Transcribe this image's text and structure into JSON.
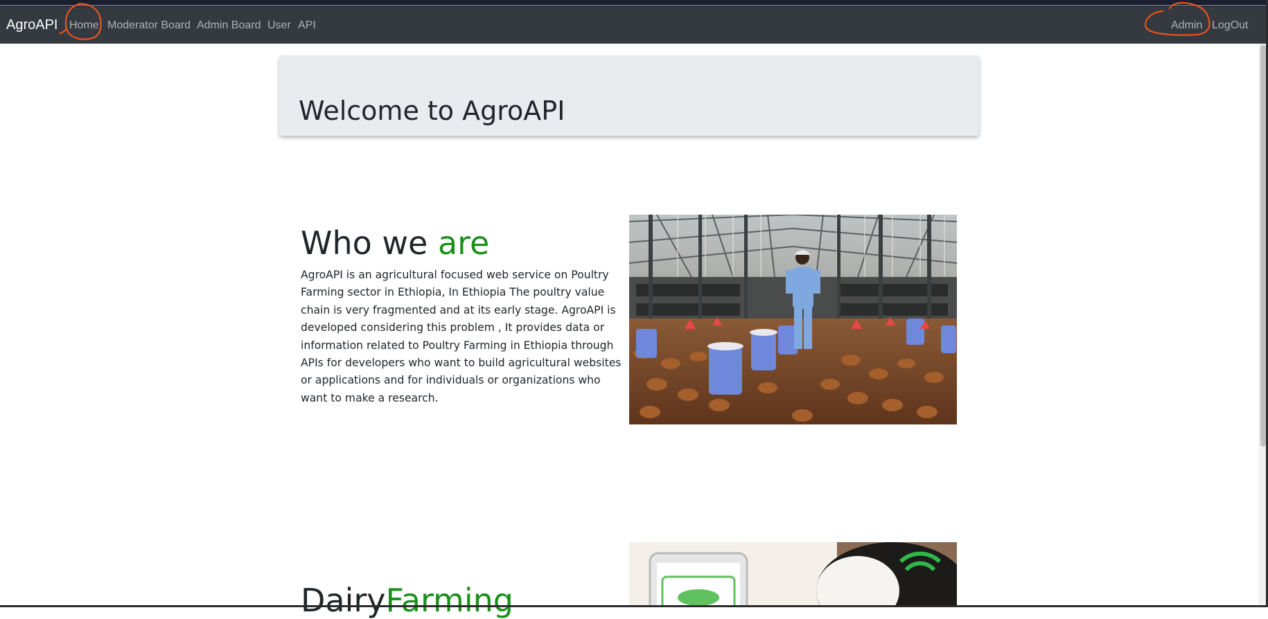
{
  "navbar": {
    "brand": "AgroAPI",
    "links": [
      "Home",
      "Moderator Board",
      "Admin Board",
      "User",
      "API"
    ],
    "user_links": [
      "Admin",
      "LogOut"
    ]
  },
  "jumbotron": {
    "title": "Welcome to AgroAPI"
  },
  "about": {
    "title_part1": "Who we ",
    "title_part2": "are",
    "text": "AgroAPI is an agricultural focused web service on Poultry Farming sector in Ethiopia, In Ethiopia The poultry value chain is very fragmented and at its early stage. AgroAPI is developed considering this problem , It provides data or information related to Poultry Farming in Ethiopia through APIs for developers who want to build agricultural websites or applications and for individuals or organizations who want to make a research."
  },
  "dairy": {
    "title_part1": "Dairy",
    "title_part2": "Farming"
  },
  "colors": {
    "navbar_bg": "#343a40",
    "accent_green": "#1a8f1a",
    "annotation": "#e8541e",
    "jumbotron_bg": "#e9ecef"
  }
}
